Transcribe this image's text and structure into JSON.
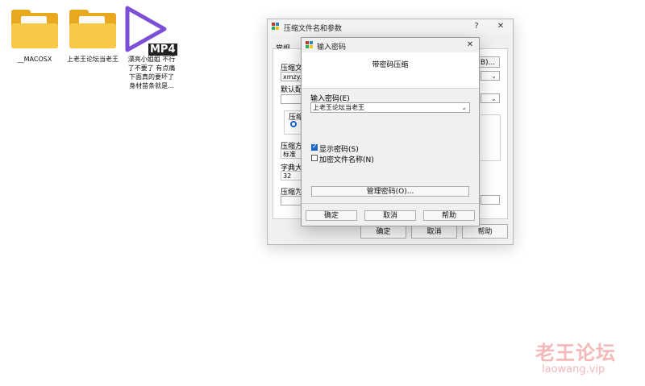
{
  "desktop": {
    "icons": [
      {
        "label": "__MACOSX",
        "type": "folder"
      },
      {
        "label": "上老王论坛当老王",
        "type": "folder"
      },
      {
        "label": "漂亮小姐姐 不行了不要了 有点痛 下面真的要坏了 身材苗条就是...",
        "type": "video",
        "badge": "MP4"
      }
    ]
  },
  "back_dialog": {
    "title": "压缩文件名和参数",
    "help_glyph": "?",
    "close_glyph": "✕",
    "tab": "常规",
    "archive_name_label": "压缩文",
    "archive_name_value": "xmzy.z",
    "browse_button": "B)...",
    "default_profile_label": "默认配",
    "format_label": "压缩文",
    "method_label": "压缩方",
    "method_value": "标准",
    "dict_label": "字典大",
    "dict_value": "32",
    "split_label": "压缩为",
    "ok": "确定",
    "cancel": "取消",
    "help": "帮助"
  },
  "password_dialog": {
    "title": "输入密码",
    "close_glyph": "✕",
    "header": "带密码压缩",
    "password_label": "输入密码(E)",
    "password_value": "上老王论坛当老王",
    "show_password": {
      "label": "显示密码(S)",
      "checked": true
    },
    "encrypt_names": {
      "label": "加密文件名称(N)",
      "checked": false
    },
    "manage_button": "管理密码(O)...",
    "ok": "确定",
    "cancel": "取消",
    "help": "帮助"
  },
  "watermark": {
    "cn": "老王论坛",
    "url": "laowang.vip"
  },
  "colors": {
    "folder": "#f7c948",
    "video_icon": "#7b4fd8",
    "check_accent": "#1a67c8",
    "watermark": "#f3b8b8"
  }
}
